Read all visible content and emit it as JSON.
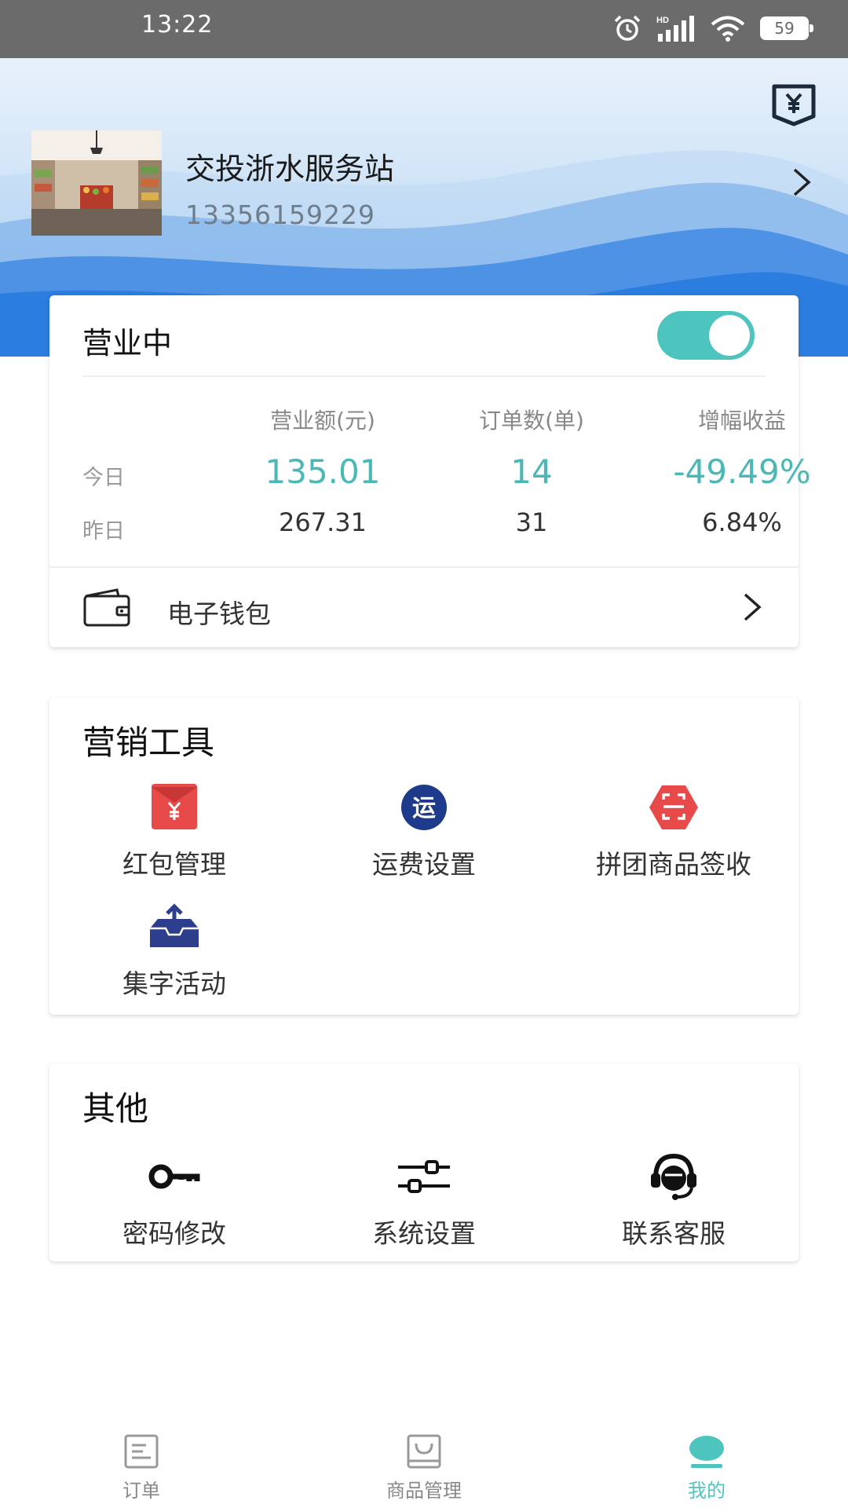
{
  "status_bar": {
    "time": "13:22",
    "network": "HD",
    "battery": "59"
  },
  "header": {
    "store_name": "交投浙水服务站",
    "phone": "13356159229",
    "wallet_icon": "yen-wallet-icon"
  },
  "business": {
    "status_label": "营业中",
    "is_open": true,
    "columns": [
      "营业额(元)",
      "订单数(单)",
      "增幅收益"
    ],
    "rows": [
      {
        "label": "今日",
        "values": [
          "135.01",
          "14",
          "-49.49%"
        ]
      },
      {
        "label": "昨日",
        "values": [
          "267.31",
          "31",
          "6.84%"
        ]
      }
    ],
    "wallet_label": "电子钱包"
  },
  "marketing": {
    "title": "营销工具",
    "tools": [
      {
        "label": "红包管理",
        "icon": "red-envelope-icon"
      },
      {
        "label": "运费设置",
        "icon": "shipping-icon",
        "glyph": "运"
      },
      {
        "label": "拼团商品签收",
        "icon": "scan-icon"
      },
      {
        "label": "集字活动",
        "icon": "inbox-upload-icon"
      }
    ]
  },
  "other": {
    "title": "其他",
    "items": [
      {
        "label": "密码修改",
        "icon": "key-icon"
      },
      {
        "label": "系统设置",
        "icon": "sliders-icon"
      },
      {
        "label": "联系客服",
        "icon": "headset-icon"
      }
    ]
  },
  "nav": {
    "items": [
      {
        "label": "订单",
        "icon": "order-list-icon"
      },
      {
        "label": "商品管理",
        "icon": "bag-icon"
      },
      {
        "label": "我的",
        "icon": "profile-icon",
        "active": true
      }
    ]
  },
  "colors": {
    "accent": "#4ec4bf",
    "header_blue": "#2b7de0"
  }
}
